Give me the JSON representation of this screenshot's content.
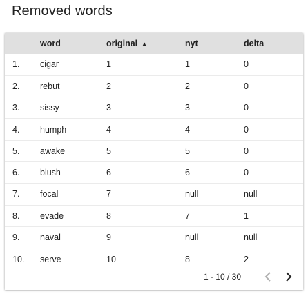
{
  "title": "Removed words",
  "table": {
    "columns": [
      "",
      "word",
      "original",
      "nyt",
      "delta"
    ],
    "sort_indicator": "▲",
    "rows": [
      [
        "1.",
        "cigar",
        "1",
        "1",
        "0"
      ],
      [
        "2.",
        "rebut",
        "2",
        "2",
        "0"
      ],
      [
        "3.",
        "sissy",
        "3",
        "3",
        "0"
      ],
      [
        "4.",
        "humph",
        "4",
        "4",
        "0"
      ],
      [
        "5.",
        "awake",
        "5",
        "5",
        "0"
      ],
      [
        "6.",
        "blush",
        "6",
        "6",
        "0"
      ],
      [
        "7.",
        "focal",
        "7",
        "null",
        "null"
      ],
      [
        "8.",
        "evade",
        "8",
        "7",
        "1"
      ],
      [
        "9.",
        "naval",
        "9",
        "null",
        "null"
      ],
      [
        "10.",
        "serve",
        "10",
        "8",
        "2"
      ]
    ]
  },
  "pagination": {
    "range": "1 - 10 / 30",
    "prev_icon": "chevron-left-icon",
    "next_icon": "chevron-right-icon"
  },
  "colors": {
    "header_bg": "#e0e0e0",
    "disabled_icon": "#b0b0b0"
  }
}
